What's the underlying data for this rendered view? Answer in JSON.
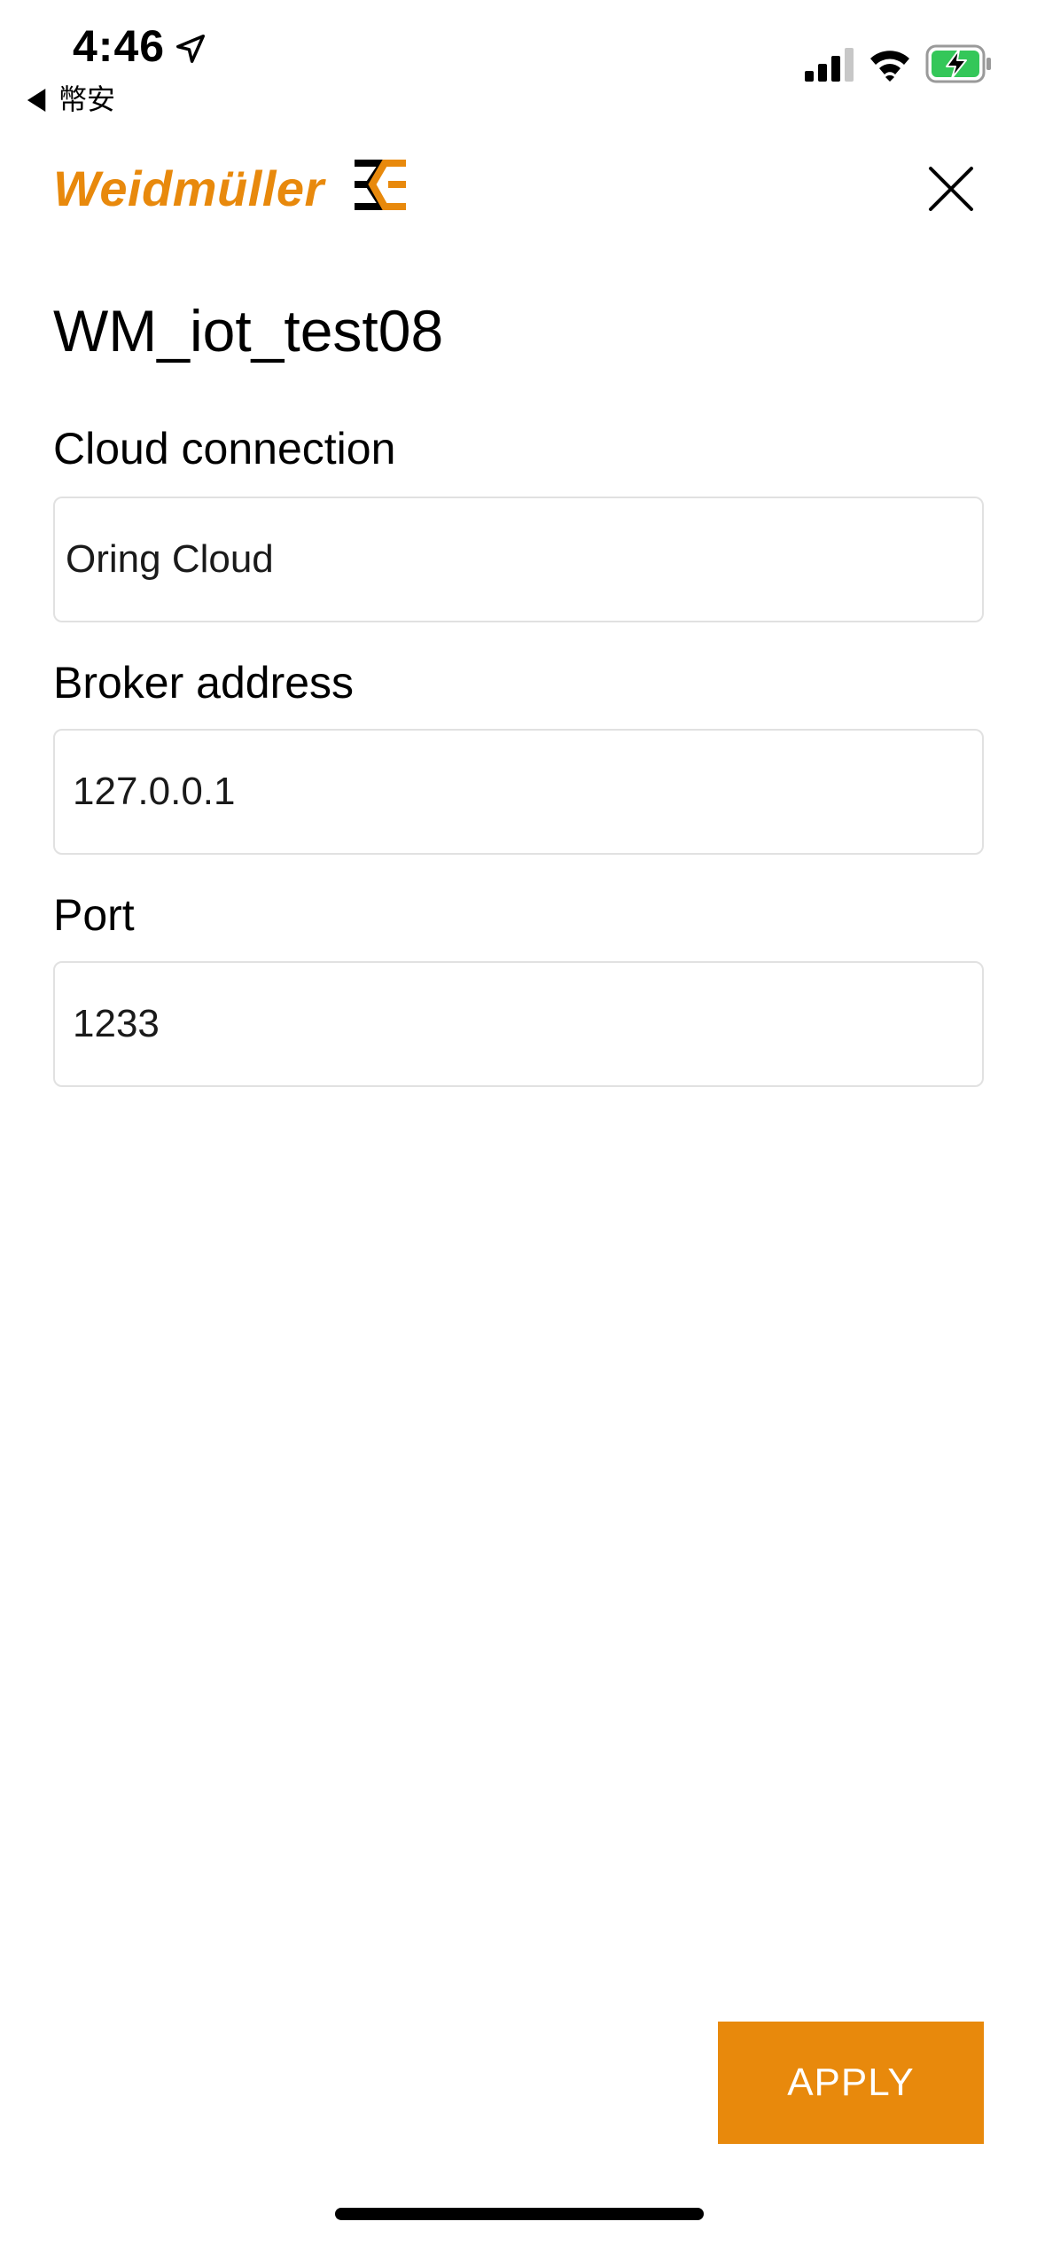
{
  "status_bar": {
    "time": "4:46",
    "back_label": "幣安",
    "battery_color": "#34c759"
  },
  "header": {
    "logo_text": "Weidmüller",
    "brand_color": "#e8890c",
    "close_icon": "close-icon"
  },
  "page": {
    "title": "WM_iot_test08"
  },
  "form": {
    "cloud_connection": {
      "label": "Cloud connection",
      "value": "Oring Cloud"
    },
    "broker_address": {
      "label": "Broker address",
      "value": "127.0.0.1"
    },
    "port": {
      "label": "Port",
      "value": "1233"
    }
  },
  "actions": {
    "apply_label": "APPLY"
  }
}
